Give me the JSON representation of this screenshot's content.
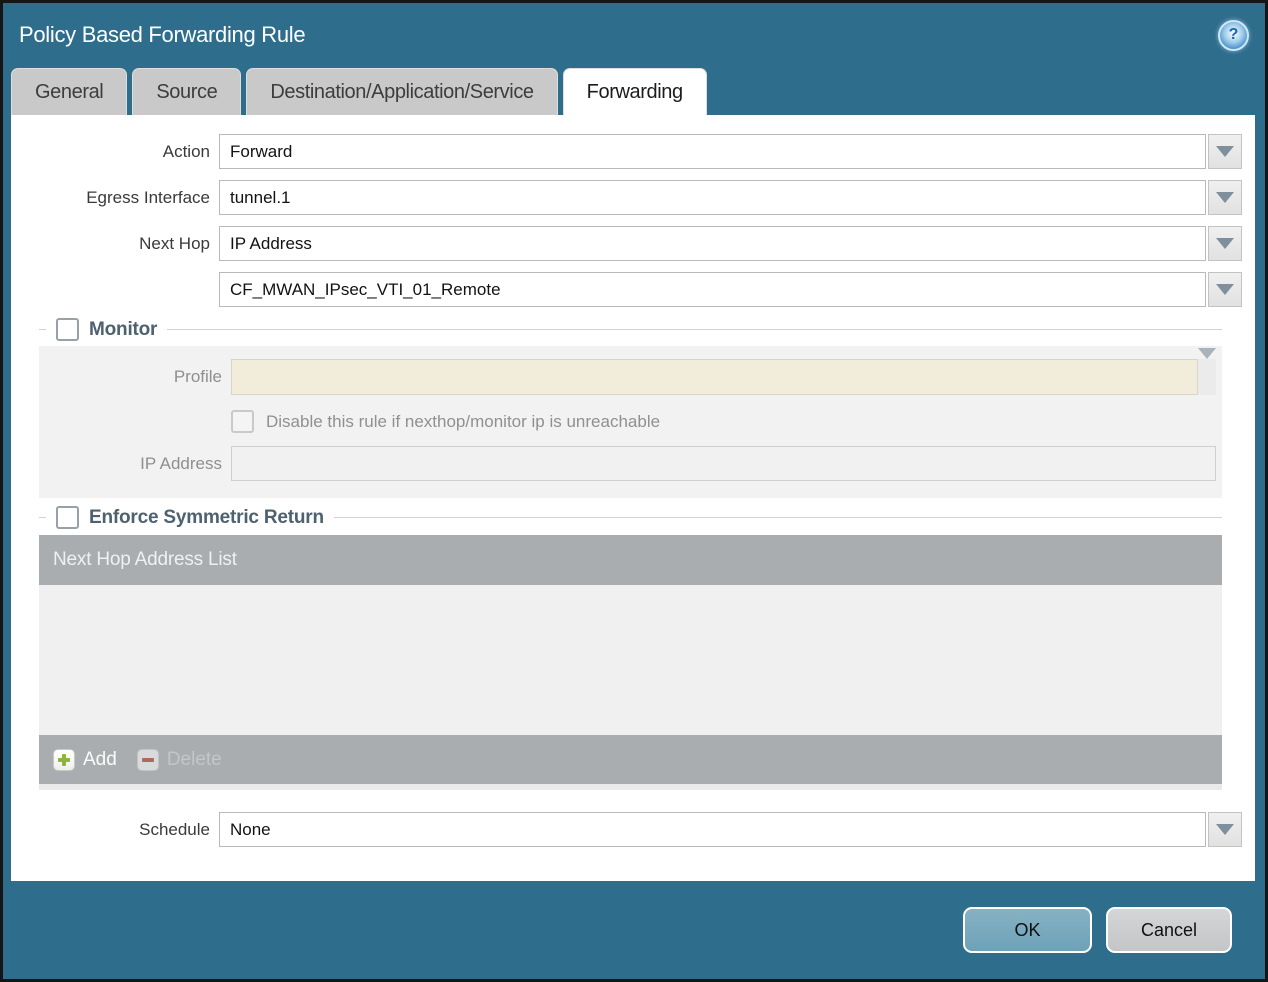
{
  "window": {
    "title": "Policy Based Forwarding Rule",
    "help_glyph": "?"
  },
  "tabs": [
    {
      "label": "General",
      "active": false
    },
    {
      "label": "Source",
      "active": false
    },
    {
      "label": "Destination/Application/Service",
      "active": false
    },
    {
      "label": "Forwarding",
      "active": true
    }
  ],
  "form": {
    "action_label": "Action",
    "action_value": "Forward",
    "egress_label": "Egress Interface",
    "egress_value": "tunnel.1",
    "next_hop_label": "Next Hop",
    "next_hop_value": "IP Address",
    "next_hop_address_value": "CF_MWAN_IPsec_VTI_01_Remote",
    "schedule_label": "Schedule",
    "schedule_value": "None"
  },
  "monitor": {
    "legend": "Monitor",
    "checked": false,
    "profile_label": "Profile",
    "profile_value": "",
    "disable_rule_label": "Disable this rule if nexthop/monitor ip is unreachable",
    "disable_rule_checked": false,
    "ip_address_label": "IP Address",
    "ip_address_value": ""
  },
  "symmetric_return": {
    "legend": "Enforce Symmetric Return",
    "checked": false,
    "table_header": "Next Hop Address List",
    "rows": [],
    "add_label": "Add",
    "delete_label": "Delete",
    "delete_enabled": false
  },
  "footer": {
    "ok_label": "OK",
    "cancel_label": "Cancel"
  },
  "colors": {
    "dialog_teal": "#2e6d8c",
    "inactive_tab_gray": "#c9c9c9",
    "disabled_field_cream": "#f2ecda",
    "table_header_gray": "#a9adb0",
    "ok_button_blue": "#74a6bb",
    "cancel_button_gray": "#c8cacc",
    "legend_slate": "#4d616f",
    "add_plus_green": "#8cb43e",
    "delete_minus_red": "#aa6a5f"
  }
}
